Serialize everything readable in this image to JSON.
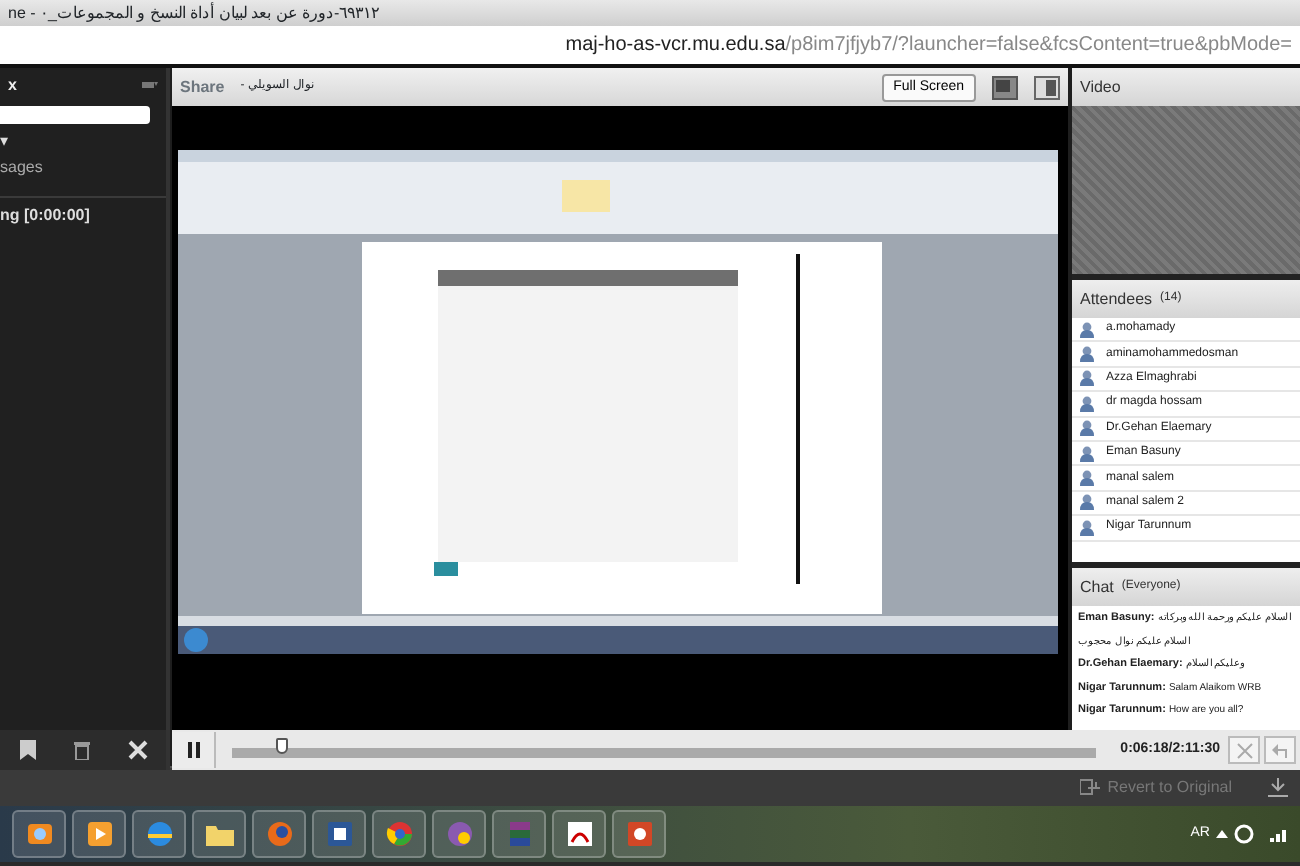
{
  "browser": {
    "title": "٦٩٣١٢-دورة عن بعد لبيان أداة النسخ و المجموعات_٠ - ne",
    "url_host": "maj-ho-as-vcr.mu.edu.sa",
    "url_path": "/p8im7jfjyb7/?launcher=false&fcsContent=true&pbMode="
  },
  "left_panel": {
    "title": "x",
    "filter": "▾",
    "filter_label": "sages",
    "entry": "ng [0:00:00]"
  },
  "share": {
    "title": "Share",
    "presenter": "نوال السويلي -",
    "full_screen": "Full Screen"
  },
  "player": {
    "level": 0.05,
    "time": "0:06:18/2:11:30"
  },
  "video": {
    "title": "Video"
  },
  "attendees": {
    "title": "Attendees",
    "count": "(14)",
    "items": [
      {
        "name": "a.mohamady"
      },
      {
        "name": "aminamohammedosman"
      },
      {
        "name": "Azza Elmaghrabi"
      },
      {
        "name": "dr magda hossam"
      },
      {
        "name": "Dr.Gehan Elaemary"
      },
      {
        "name": "Eman Basuny"
      },
      {
        "name": "manal salem"
      },
      {
        "name": "manal salem 2"
      },
      {
        "name": "Nigar Tarunnum"
      }
    ]
  },
  "chat": {
    "title": "Chat",
    "audience": "(Everyone)",
    "messages": [
      {
        "sender": "Eman Basuny:",
        "text": "السلام عليكم ورحمة الله وبركاته"
      },
      {
        "text": "السلام عليكم نوال محجوب"
      },
      {
        "sender": "Dr.Gehan Elaemary:",
        "text": "وعليكم السلام"
      },
      {
        "sender": "Nigar Tarunnum:",
        "text": "Salam Alaikom WRB"
      },
      {
        "sender": "Nigar Tarunnum:",
        "text": "How are you all?"
      }
    ]
  },
  "revert": {
    "label": "Revert to Original",
    "disabled": true
  },
  "taskbar": {
    "language": "AR"
  }
}
